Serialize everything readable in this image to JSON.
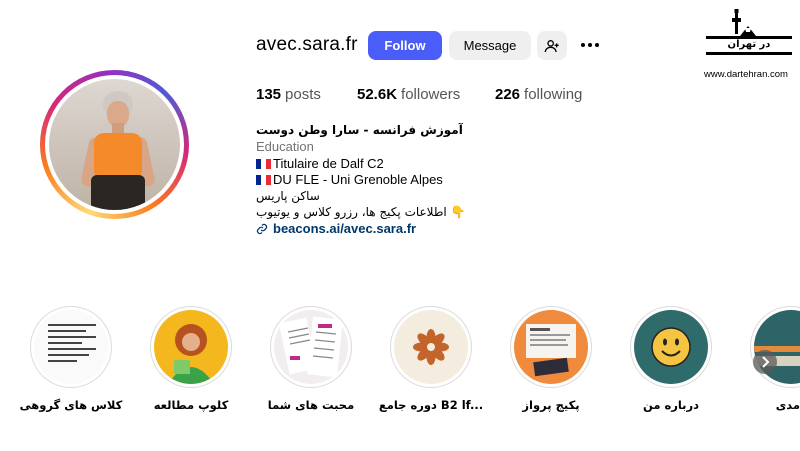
{
  "profile": {
    "username": "avec.sara.fr",
    "follow_label": "Follow",
    "message_label": "Message",
    "add_person_icon": "person-add-icon",
    "more_icon": "more-options-icon"
  },
  "stats": {
    "posts_count": "135",
    "posts_label": "posts",
    "followers_count": "52.6K",
    "followers_label": "followers",
    "following_count": "226",
    "following_label": "following"
  },
  "bio": {
    "name": "آموزش فرانسه - سارا وطن دوست",
    "category": "Education",
    "line1": "Titulaire de Dalf C2",
    "line2": "DU FLE - Uni Grenoble Alpes",
    "line3": "ساکن پاریس",
    "line4": "اطلاعات پکیج ها، رزرو کلاس و یوتیوب 👇",
    "link": "beacons.ai/avec.sara.fr"
  },
  "watermark": {
    "logo_text": "در تهران",
    "url": "www.dartehran.com"
  },
  "highlights": [
    {
      "label": "کلاس های گروهی"
    },
    {
      "label": "کلوپ مطالعه"
    },
    {
      "label": "محبت های شما"
    },
    {
      "label": "دوره جامع B2 lf..."
    },
    {
      "label": "پکیج پرواز"
    },
    {
      "label": "درباره من"
    },
    {
      "label": "مدی"
    }
  ],
  "colors": {
    "follow_button": "#4a5df9",
    "link": "#00376b",
    "secondary_text": "#737373"
  }
}
